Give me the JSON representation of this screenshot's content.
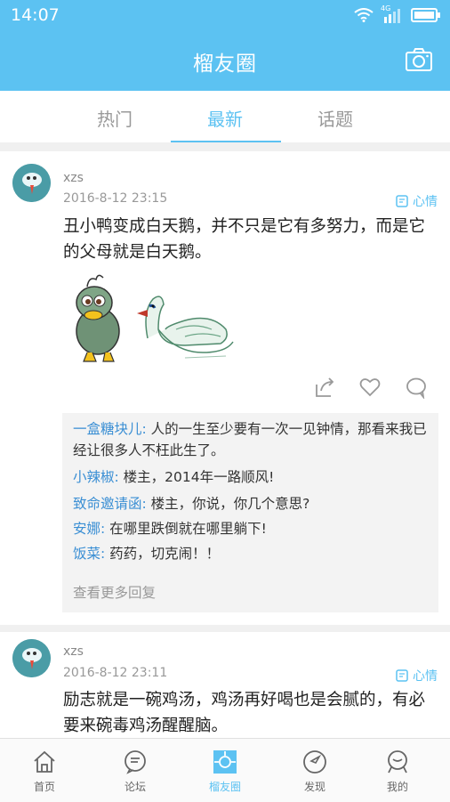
{
  "status": {
    "time": "14:07",
    "network": "4G"
  },
  "header": {
    "title": "榴友圈"
  },
  "tabs": [
    {
      "label": "热门",
      "active": false
    },
    {
      "label": "最新",
      "active": true
    },
    {
      "label": "话题",
      "active": false
    }
  ],
  "posts": [
    {
      "user": "xzs",
      "time": "2016-8-12 23:15",
      "mood": "心情",
      "content": "丑小鸭变成白天鹅，并不只是它有多努力，而是它的父母就是白天鹅。",
      "comments": [
        {
          "name": "一盒糖块儿:",
          "text": "人的一生至少要有一次一见钟情，那看来我已经让很多人不枉此生了。"
        },
        {
          "name": "小辣椒:",
          "text": "楼主，2014年一路顺风!"
        },
        {
          "name": "致命邀请函:",
          "text": "楼主，你说，你几个意思?"
        },
        {
          "name": "安娜:",
          "text": "在哪里跌倒就在哪里躺下!"
        },
        {
          "name": "饭菜:",
          "text": "药药，切克闹！！"
        }
      ],
      "more_replies": "查看更多回复"
    },
    {
      "user": "xzs",
      "time": "2016-8-12 23:11",
      "mood": "心情",
      "content": "励志就是一碗鸡汤，鸡汤再好喝也是会腻的，有必要来碗毒鸡汤醒醒脑。"
    }
  ],
  "nav": [
    {
      "label": "首页",
      "icon": "home-icon"
    },
    {
      "label": "论坛",
      "icon": "forum-icon"
    },
    {
      "label": "榴友圈",
      "icon": "circle-icon",
      "active": true
    },
    {
      "label": "发现",
      "icon": "discover-icon"
    },
    {
      "label": "我的",
      "icon": "profile-icon"
    }
  ],
  "colors": {
    "accent": "#5cc2f2",
    "commenter": "#3b8fd4"
  }
}
